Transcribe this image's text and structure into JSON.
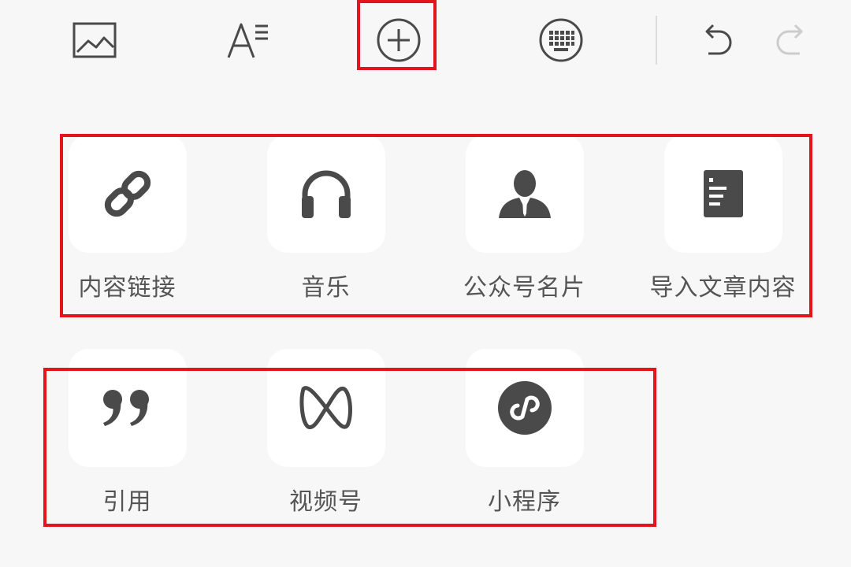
{
  "toolbar": {
    "items": [
      {
        "id": "image",
        "icon": "image-icon"
      },
      {
        "id": "text-format",
        "icon": "text-format-icon"
      },
      {
        "id": "insert",
        "icon": "plus-circle-icon"
      },
      {
        "id": "keyboard",
        "icon": "keyboard-icon"
      },
      {
        "id": "undo",
        "icon": "undo-icon"
      },
      {
        "id": "redo",
        "icon": "redo-icon",
        "disabled": true
      }
    ]
  },
  "insert_menu": {
    "rows": [
      {
        "items": [
          {
            "label": "内容链接",
            "icon": "link-icon"
          },
          {
            "label": "音乐",
            "icon": "headphones-icon"
          },
          {
            "label": "公众号名片",
            "icon": "person-card-icon"
          },
          {
            "label": "导入文章内容",
            "icon": "document-icon"
          }
        ]
      },
      {
        "items": [
          {
            "label": "引用",
            "icon": "quote-icon"
          },
          {
            "label": "视频号",
            "icon": "channels-icon"
          },
          {
            "label": "小程序",
            "icon": "mini-program-icon"
          }
        ]
      }
    ]
  },
  "colors": {
    "background": "#f7f7f7",
    "tile": "#ffffff",
    "icon": "#4a4a4a",
    "label": "#555555",
    "highlight": "#e3141b",
    "disabled": "#cccccc"
  }
}
